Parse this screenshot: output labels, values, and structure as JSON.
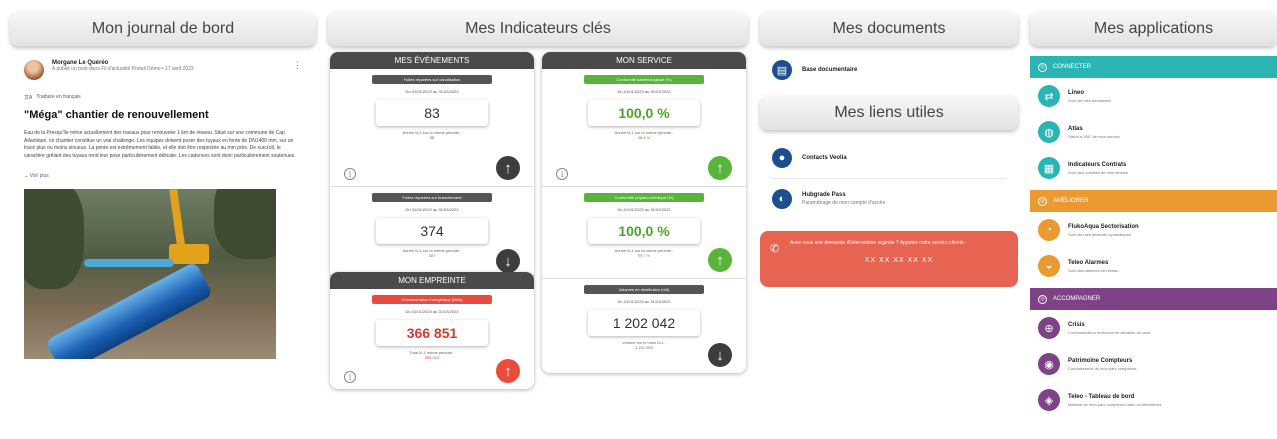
{
  "journal": {
    "title": "Mon journal de bord",
    "author": "Morgane Le Quéréo",
    "author_sub": "A publié un post dans Fil d'actualité Portail Démo • 17 avril 2023",
    "translate": "Traduire en français",
    "post_title": "\"Méga\" chantier de renouvellement",
    "post_text": "Eau de la Presqu'île mène actuellement des travaux pour renouveler 1 km de réseau. Situé sur une commune de Cap Atlantique, ce chantier constitue un vrai challenge. Les équipes doivent poser des tuyaux en fonte de DN1400 mm, sur un tracé plus ou moins sinueux. La pente est extrêmement faible, et elle doit être respectée au mm près. De surcroît, le caractère grêlant des tuyaux rend leur pose particulièrement délicate. Les cadences sont donc particulièrement soutenues.",
    "see_more": "Voir plus"
  },
  "indicators": {
    "title": "Mes Indicateurs clés",
    "events": {
      "title": "MES ÉVÈNEMENTS",
      "items": [
        {
          "tag": "Fuites réparées sur canalisation",
          "dates": "Du 01/01/2023 au 31/03/2023",
          "value": "83",
          "note1": "Année N-1 sur la même période :",
          "note2": "98",
          "arrow": "↑"
        },
        {
          "tag": "Fuites réparées sur branchement",
          "dates": "Du 01/01/2023 au 31/03/2023",
          "value": "374",
          "note1": "Année N-1 sur la même période :",
          "note2": "407",
          "arrow": "↓"
        }
      ]
    },
    "service": {
      "title": "MON SERVICE",
      "items": [
        {
          "tag": "Conformité bactériologique (%)",
          "dates": "Du 01/01/2023 au 31/03/2023",
          "value": "100,0 %",
          "note1": "Année N-1 sur la même période :",
          "note2": "98,8 %",
          "arrow": "↑"
        },
        {
          "tag": "Conformité physico-chimique (%)",
          "dates": "Du 01/01/2023 au 31/03/2023",
          "value": "100,0 %",
          "note1": "Année N-1 sur la même période :",
          "note2": "99,7 %",
          "arrow": "↑"
        },
        {
          "tag": "Volumes en distribution (m3)",
          "dates": "Du 01/01/2023 au 31/03/2023",
          "value": "1 202 042",
          "note1": "Volume sur le mois N-1 :",
          "note2": "1 211 093",
          "arrow": "↓"
        }
      ]
    },
    "footprint": {
      "title": "MON EMPREINTE",
      "items": [
        {
          "tag": "Consommation énergétique (kWh)",
          "dates": "Du 01/01/2023 au 31/03/2023",
          "value": "366 851",
          "note1": "Total N-1 même période :",
          "note2": "354 010",
          "arrow": "↑"
        }
      ]
    }
  },
  "documents": {
    "title": "Mes documents",
    "items": [
      {
        "label": "Base documentaire"
      }
    ]
  },
  "links": {
    "title": "Mes liens utiles",
    "items": [
      {
        "label": "Contacts Veolia",
        "sub": ""
      },
      {
        "label": "Hubgrade Pass",
        "sub": "Paramétrage de mon compte d'accès"
      }
    ]
  },
  "alert": {
    "text": "Avez-vous une demande d'intervention urgente ? Appelez notre service clients :",
    "number": "XX XX XX XX XX"
  },
  "applications": {
    "title": "Mes applications",
    "categories": [
      {
        "label": "CONNECTER",
        "color": "#2ab4b4",
        "items": [
          {
            "name": "Lineo",
            "desc": "Suivi de mes demandes"
          },
          {
            "name": "Atlas",
            "desc": "Vision à 360° de mon service"
          },
          {
            "name": "Indicateurs Contrats",
            "desc": "Suivi des activités de mon service"
          }
        ]
      },
      {
        "label": "AMÉLIORER",
        "color": "#ea9a31",
        "items": [
          {
            "name": "FlukoAqua Sectorisation",
            "desc": "Suivi de mes secteurs hydrauliques"
          },
          {
            "name": "Teleo Alarmes",
            "desc": "Suivi des alarmes du réseau"
          }
        ]
      },
      {
        "label": "ACCOMPAGNER",
        "color": "#7e4287",
        "items": [
          {
            "name": "Crisis",
            "desc": "Communication renforcée en situation de crise"
          },
          {
            "name": "Patrimoine Compteurs",
            "desc": "Connaissance de mon parc compteurs"
          },
          {
            "name": "Teleo - Tableau de bord",
            "desc": "Maîtrise de mon parc compteurs radio ou télérelevés"
          }
        ]
      }
    ]
  }
}
